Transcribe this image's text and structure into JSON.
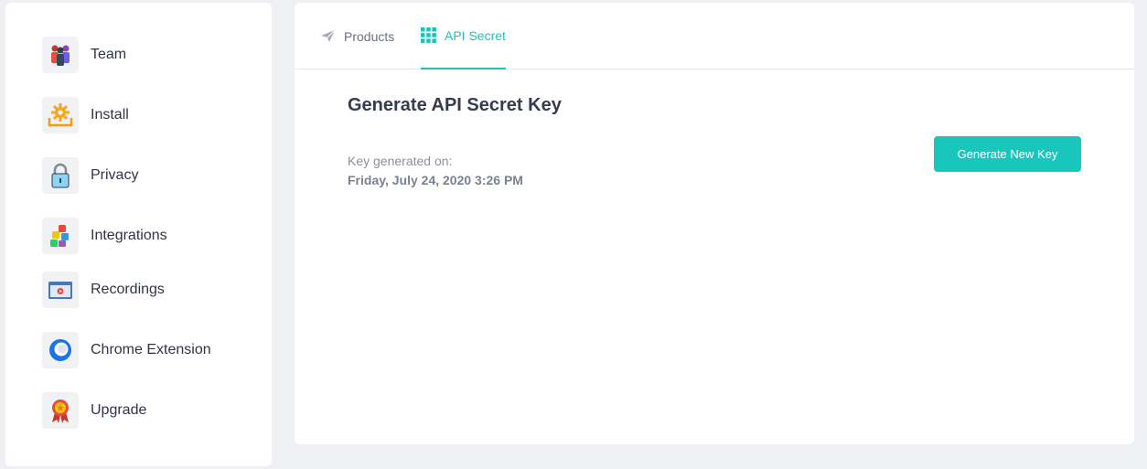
{
  "sidebar": {
    "items": [
      {
        "label": "Team",
        "icon": "team-icon"
      },
      {
        "label": "Install",
        "icon": "install-icon"
      },
      {
        "label": "Privacy",
        "icon": "lock-icon"
      },
      {
        "label": "Integrations",
        "icon": "puzzle-icon"
      },
      {
        "label": "Recordings",
        "icon": "video-icon"
      },
      {
        "label": "Chrome Extension",
        "icon": "chrome-icon"
      },
      {
        "label": "Upgrade",
        "icon": "ribbon-icon"
      }
    ]
  },
  "tabs": [
    {
      "label": "Products",
      "icon": "paper-plane-icon",
      "active": false
    },
    {
      "label": "API Secret",
      "icon": "grid-icon",
      "active": true
    }
  ],
  "content": {
    "heading": "Generate API Secret Key",
    "key_label": "Key generated on:",
    "key_date": "Friday, July 24, 2020 3:26 PM",
    "button_label": "Generate New Key"
  },
  "colors": {
    "accent": "#18c6bb",
    "background": "#eef0f3",
    "text": "#2f3447"
  }
}
